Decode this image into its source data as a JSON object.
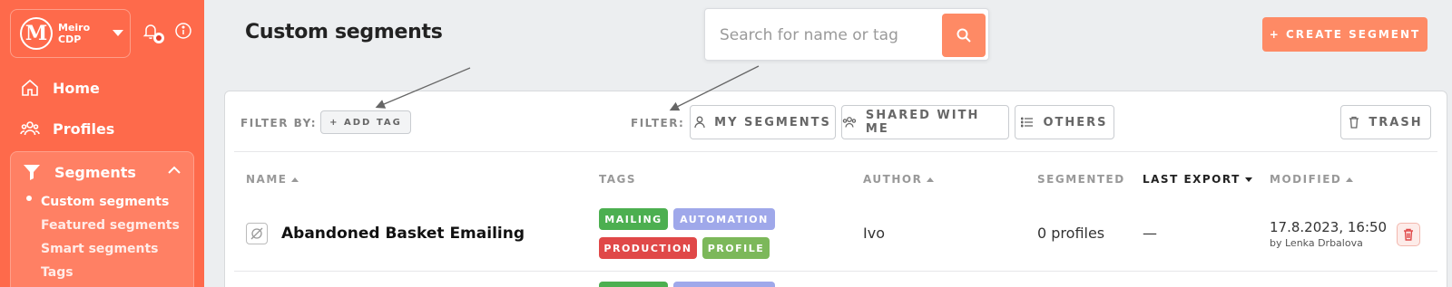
{
  "brand": {
    "name": "Meiro CDP",
    "logo_letter": "M"
  },
  "sidebar": {
    "items": [
      {
        "label": "Home",
        "icon": "home-icon"
      },
      {
        "label": "Profiles",
        "icon": "users-icon"
      }
    ],
    "segments": {
      "label": "Segments",
      "icon": "filter-icon",
      "sub_items": [
        "Custom segments",
        "Featured segments",
        "Smart segments",
        "Tags"
      ],
      "active": "Custom segments"
    }
  },
  "header": {
    "title": "Custom segments",
    "search_placeholder": "Search for name or tag",
    "create_label": "+ CREATE SEGMENT"
  },
  "filters": {
    "filter_by_label": "FILTER BY:",
    "add_tag_label": "+ ADD TAG",
    "filter_label": "FILTER:",
    "my_segments": "MY SEGMENTS",
    "shared_with_me": "SHARED WITH ME",
    "others": "OTHERS",
    "trash": "TRASH"
  },
  "table": {
    "columns": {
      "name": "NAME",
      "tags": "TAGS",
      "author": "AUTHOR",
      "segmented": "SEGMENTED",
      "last_export": "LAST EXPORT",
      "modified": "MODIFIED"
    },
    "rows": [
      {
        "name": "Abandoned Basket Emailing",
        "tags": [
          {
            "label": "MAILING",
            "color": "#4caf50"
          },
          {
            "label": "AUTOMATION",
            "color": "#9fa8ea"
          },
          {
            "label": "PRODUCTION",
            "color": "#e04848"
          },
          {
            "label": "PROFILE",
            "color": "#7cb85a"
          }
        ],
        "author": "Ivo",
        "segmented": "0 profiles",
        "last_export": "—",
        "modified_date": "17.8.2023, 16:50",
        "modified_by": "by Lenka Drbalova"
      }
    ]
  },
  "colors": {
    "sidebar": "#fe6a4b",
    "accent": "#fe8a65"
  }
}
